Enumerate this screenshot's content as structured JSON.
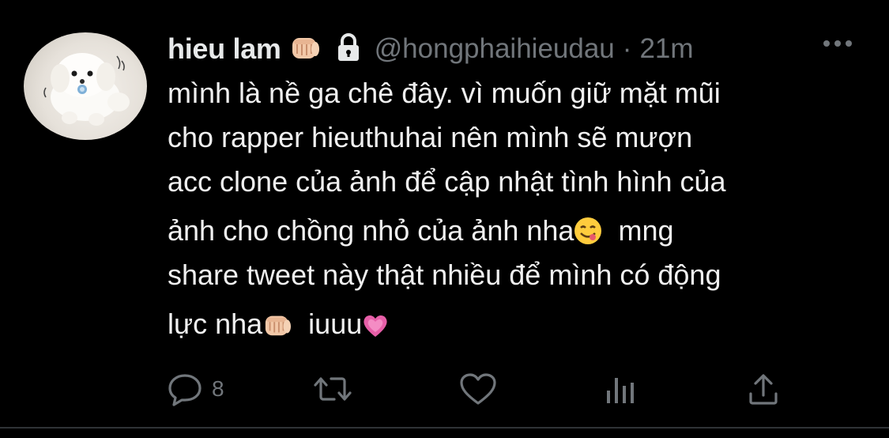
{
  "tweet": {
    "display_name": "hieu lam",
    "handle": "@hongphaihieudau",
    "separator": "·",
    "time": "21m",
    "body_lines": [
      "mình là nề ga chê đây. vì muốn giữ mặt mũi",
      "cho rapper hieuthuhai nên mình sẽ mượn",
      "acc clone của ảnh để cập nhật tình hình của",
      "ảnh cho chồng nhỏ của ảnh nha",
      "  mng",
      "share tweet này thật nhiều để mình có động",
      "lực nha",
      "  iuuu"
    ],
    "icons": {
      "fist": "fist-bump-emoji",
      "lock": "lock-icon",
      "more": "more-icon",
      "yum": "face-savoring-food-emoji",
      "heart": "growing-heart-emoji"
    }
  },
  "actions": {
    "reply_count": "8",
    "retweet_count": "",
    "like_count": "",
    "views_count": "",
    "icons": [
      "reply-icon",
      "retweet-icon",
      "like-icon",
      "analytics-icon",
      "share-icon"
    ]
  },
  "colors": {
    "background": "#000000",
    "text": "#e7e9ea",
    "secondary": "#71767b",
    "heart": "#e75fa8"
  }
}
